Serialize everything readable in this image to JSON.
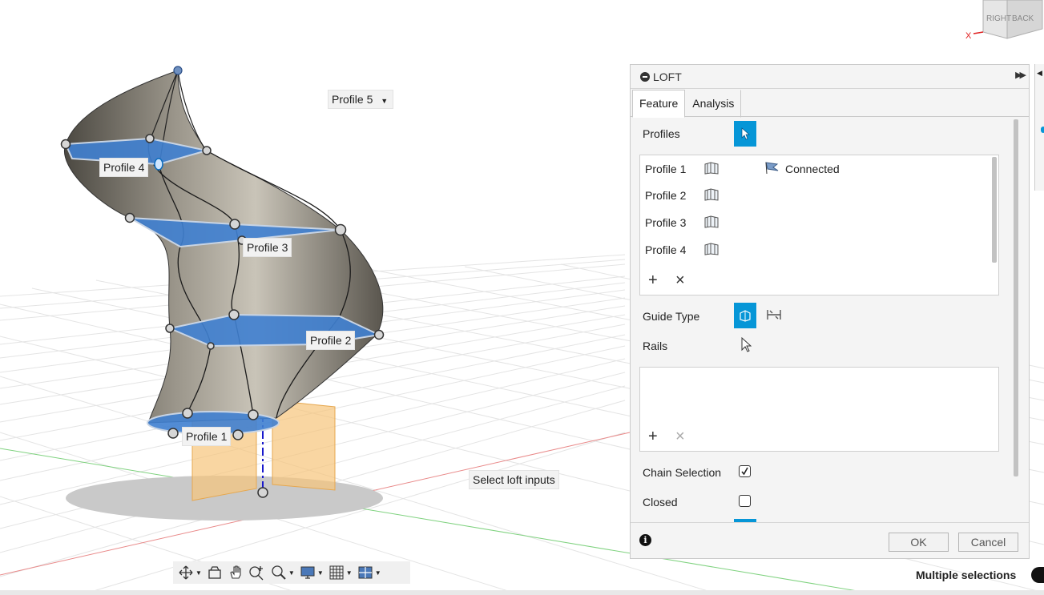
{
  "viewport": {
    "profile_labels": [
      "Profile 1",
      "Profile 2",
      "Profile 3",
      "Profile 4"
    ],
    "profile5_dropdown": "Profile 5",
    "hint": "Select loft inputs",
    "viewcube": {
      "right": "RIGHT",
      "back": "BACK",
      "axis_x": "X"
    }
  },
  "panel": {
    "title": "LOFT",
    "tabs": [
      "Feature",
      "Analysis"
    ],
    "profiles_label": "Profiles",
    "profiles": [
      {
        "label": "Profile 1",
        "icon": "section-icon",
        "status": "Connected",
        "status_icon": "connected-flag-icon"
      },
      {
        "label": "Profile 2",
        "icon": "section-icon"
      },
      {
        "label": "Profile 3",
        "icon": "section-icon"
      },
      {
        "label": "Profile 4",
        "icon": "section-icon"
      }
    ],
    "add": "+",
    "remove": "×",
    "guide_type_label": "Guide Type",
    "rails_label": "Rails",
    "chain_selection_label": "Chain Selection",
    "chain_selection_checked": true,
    "closed_label": "Closed",
    "closed_checked": false,
    "ok_label": "OK",
    "cancel_label": "Cancel"
  },
  "navbar": {
    "items": [
      "orbit-icon",
      "look-at-icon",
      "pan-icon",
      "zoom-window-icon",
      "zoom-icon",
      "display-settings-icon",
      "grid-icon",
      "viewports-icon"
    ]
  },
  "status": "Multiple selections",
  "colors": {
    "accent": "#0696d7",
    "profile_fill": "#3f7fd0",
    "surface": "#8a857a",
    "body_fill": "#f6c57a"
  }
}
